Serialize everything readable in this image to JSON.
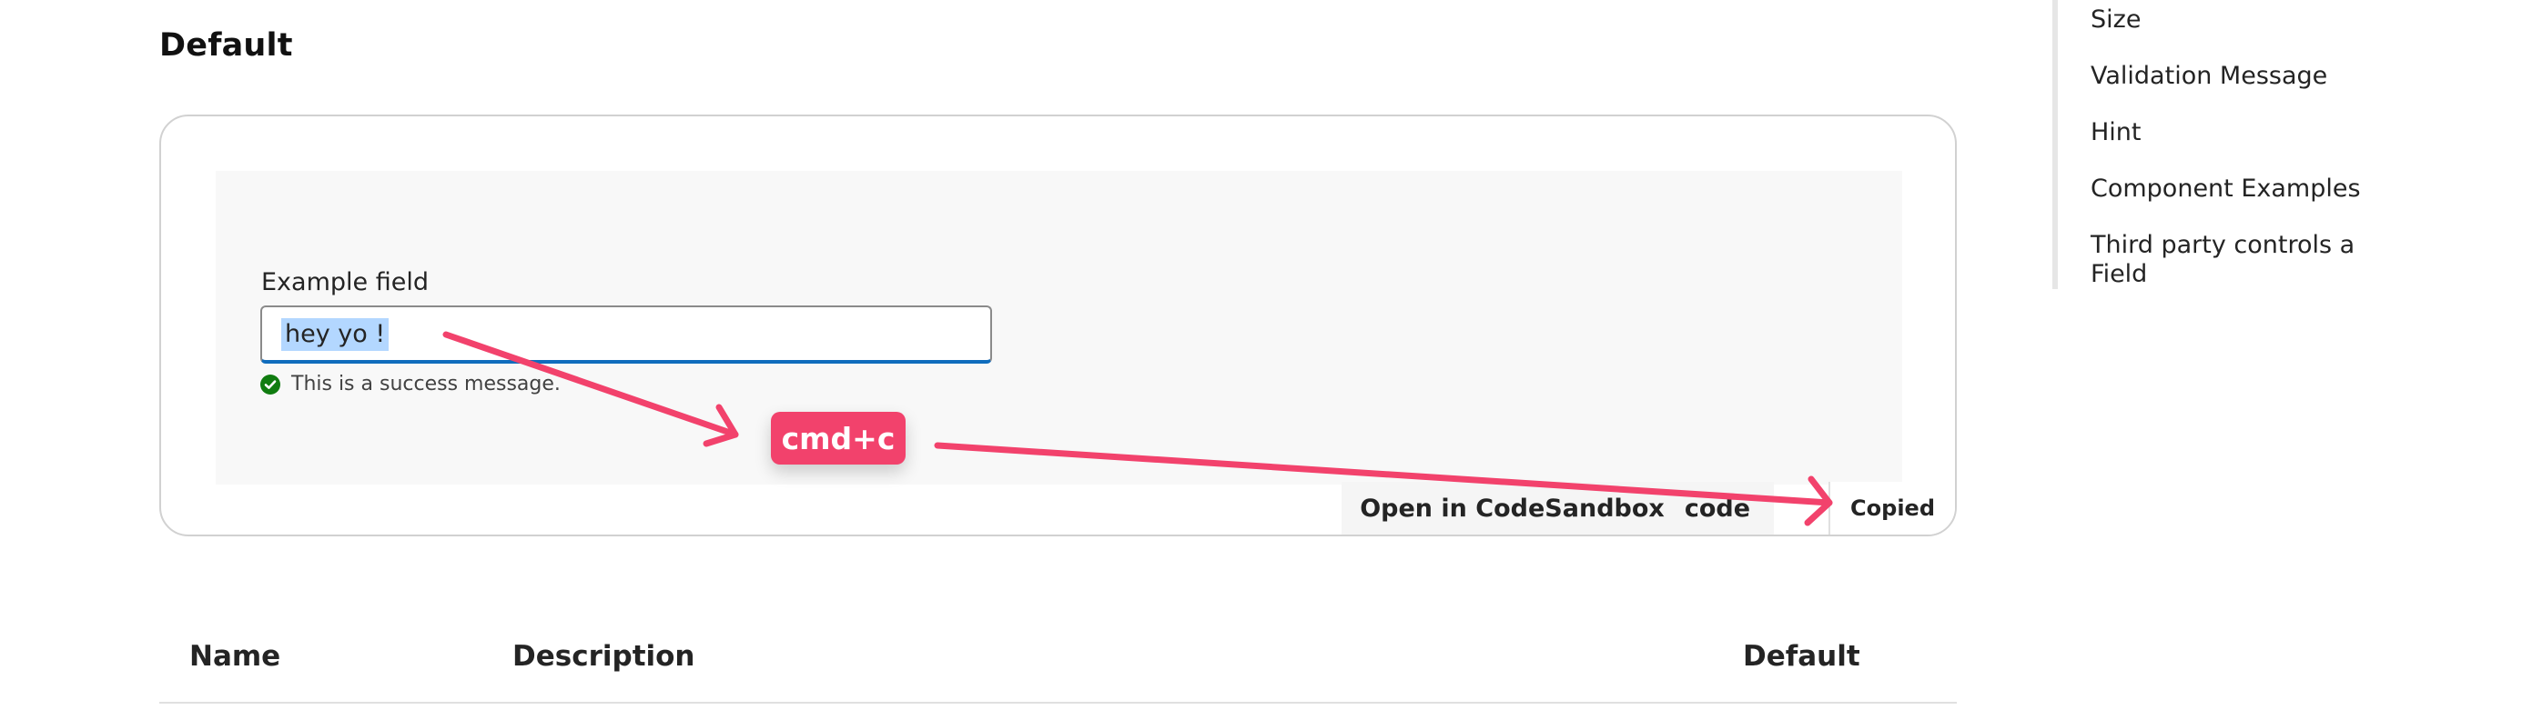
{
  "section": {
    "heading": "Default"
  },
  "example": {
    "field_label": "Example field",
    "field_value": "hey yo !",
    "validation_message": "This is a success message.",
    "validation_icon": "checkmark-circle-icon",
    "success_color": "#107c10",
    "open_sandbox_label": "Open in CodeSandbox",
    "code_label": "code",
    "copied_label": "Copied"
  },
  "annotation": {
    "shortcut": "cmd+c",
    "arrow_color": "#f2426c",
    "arrow_icon": "arrow-icon"
  },
  "toc": {
    "items": [
      {
        "label": "Size"
      },
      {
        "label": "Validation Message"
      },
      {
        "label": "Hint"
      },
      {
        "label": "Component Examples"
      },
      {
        "label": "Third party controls a Field"
      }
    ]
  },
  "props_table": {
    "headers": [
      "Name",
      "Description",
      "Default"
    ]
  }
}
